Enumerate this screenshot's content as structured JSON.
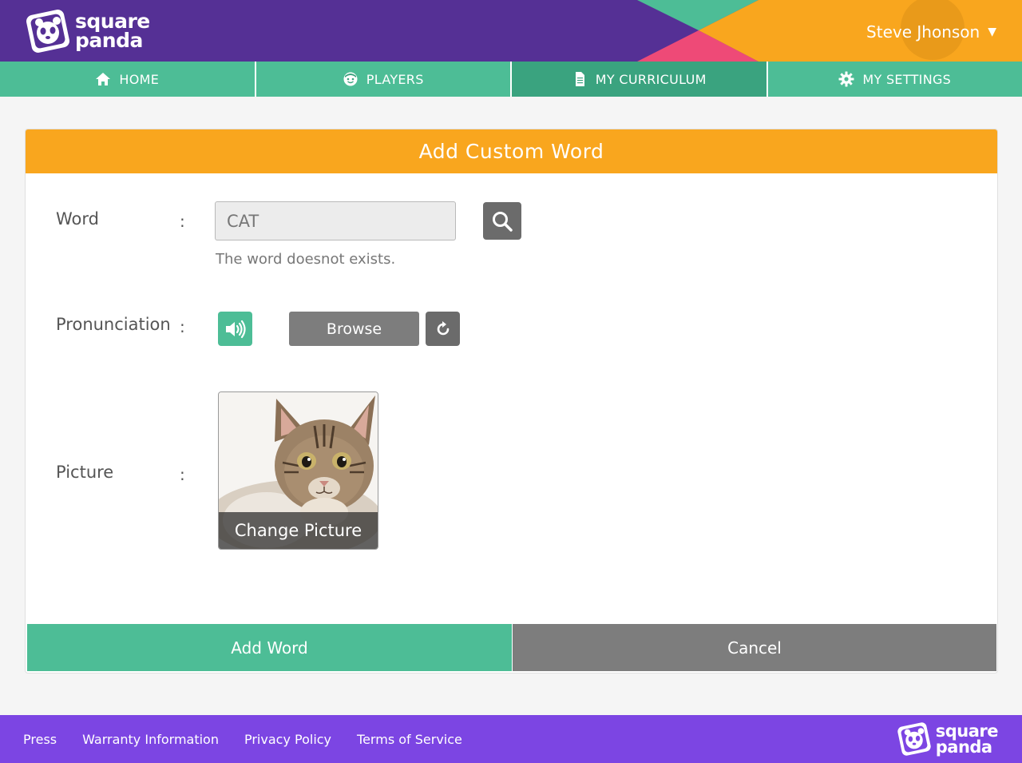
{
  "header": {
    "logo_line1": "square",
    "logo_line2": "panda",
    "user_name": "Steve Jhonson",
    "caret": "▼"
  },
  "nav": {
    "items": [
      {
        "label": "HOME",
        "icon": "home-icon"
      },
      {
        "label": "PLAYERS",
        "icon": "face-icon"
      },
      {
        "label": "MY CURRICULUM",
        "icon": "document-icon",
        "active": true
      },
      {
        "label": "MY SETTINGS",
        "icon": "gear-icon"
      }
    ]
  },
  "panel": {
    "title": "Add Custom Word",
    "word_label": "Word",
    "word_value": "CAT",
    "word_message": "The word doesnot exists.",
    "pronunciation_label": "Pronunciation",
    "browse_label": "Browse",
    "picture_label": "Picture",
    "change_picture_label": "Change Picture",
    "colon": ":",
    "add_button": "Add Word",
    "cancel_button": "Cancel"
  },
  "footer": {
    "links": [
      "Press",
      "Warranty Information",
      "Privacy Policy",
      "Terms of Service"
    ],
    "logo_line1": "square",
    "logo_line2": "panda"
  },
  "colors": {
    "header_purple": "#553095",
    "accent_orange": "#f9a61e",
    "accent_green": "#4dbd96",
    "accent_pink": "#ee4a77",
    "footer_purple": "#7c45e3",
    "button_gray": "#7d7d7d"
  }
}
